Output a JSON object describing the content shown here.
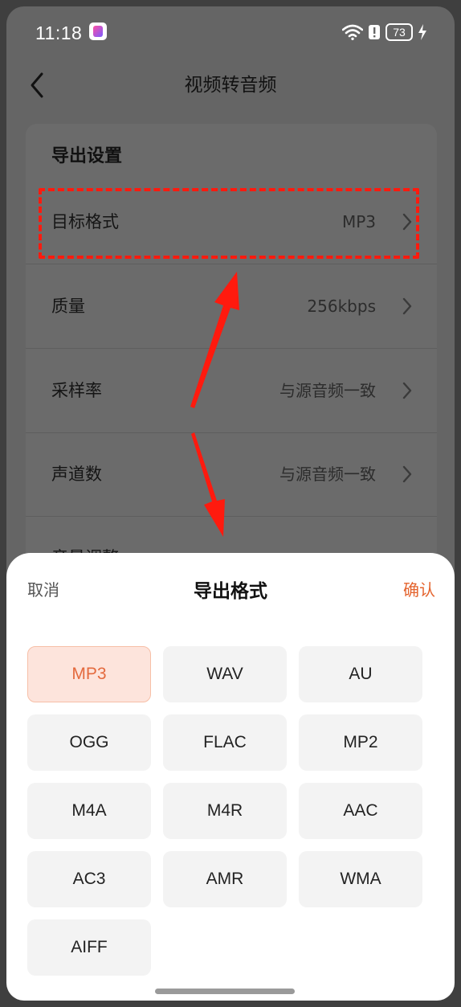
{
  "status_bar": {
    "time": "11:18",
    "battery": "73"
  },
  "header": {
    "title": "视频转音频",
    "back_icon": "chevron-left-icon"
  },
  "settings": {
    "section_title": "导出设置",
    "rows": [
      {
        "label": "目标格式",
        "value": "MP3"
      },
      {
        "label": "质量",
        "value": "256kbps"
      },
      {
        "label": "采样率",
        "value": "与源音频一致"
      },
      {
        "label": "声道数",
        "value": "与源音频一致"
      },
      {
        "label": "音量调整",
        "value": ""
      }
    ]
  },
  "annotation": {
    "highlight_color": "#ff1a0e"
  },
  "sheet": {
    "cancel_label": "取消",
    "title": "导出格式",
    "confirm_label": "确认",
    "accent_color": "#e4632d",
    "selected_format": "MP3",
    "formats": [
      "MP3",
      "WAV",
      "AU",
      "OGG",
      "FLAC",
      "MP2",
      "M4A",
      "M4R",
      "AAC",
      "AC3",
      "AMR",
      "WMA",
      "AIFF"
    ]
  }
}
